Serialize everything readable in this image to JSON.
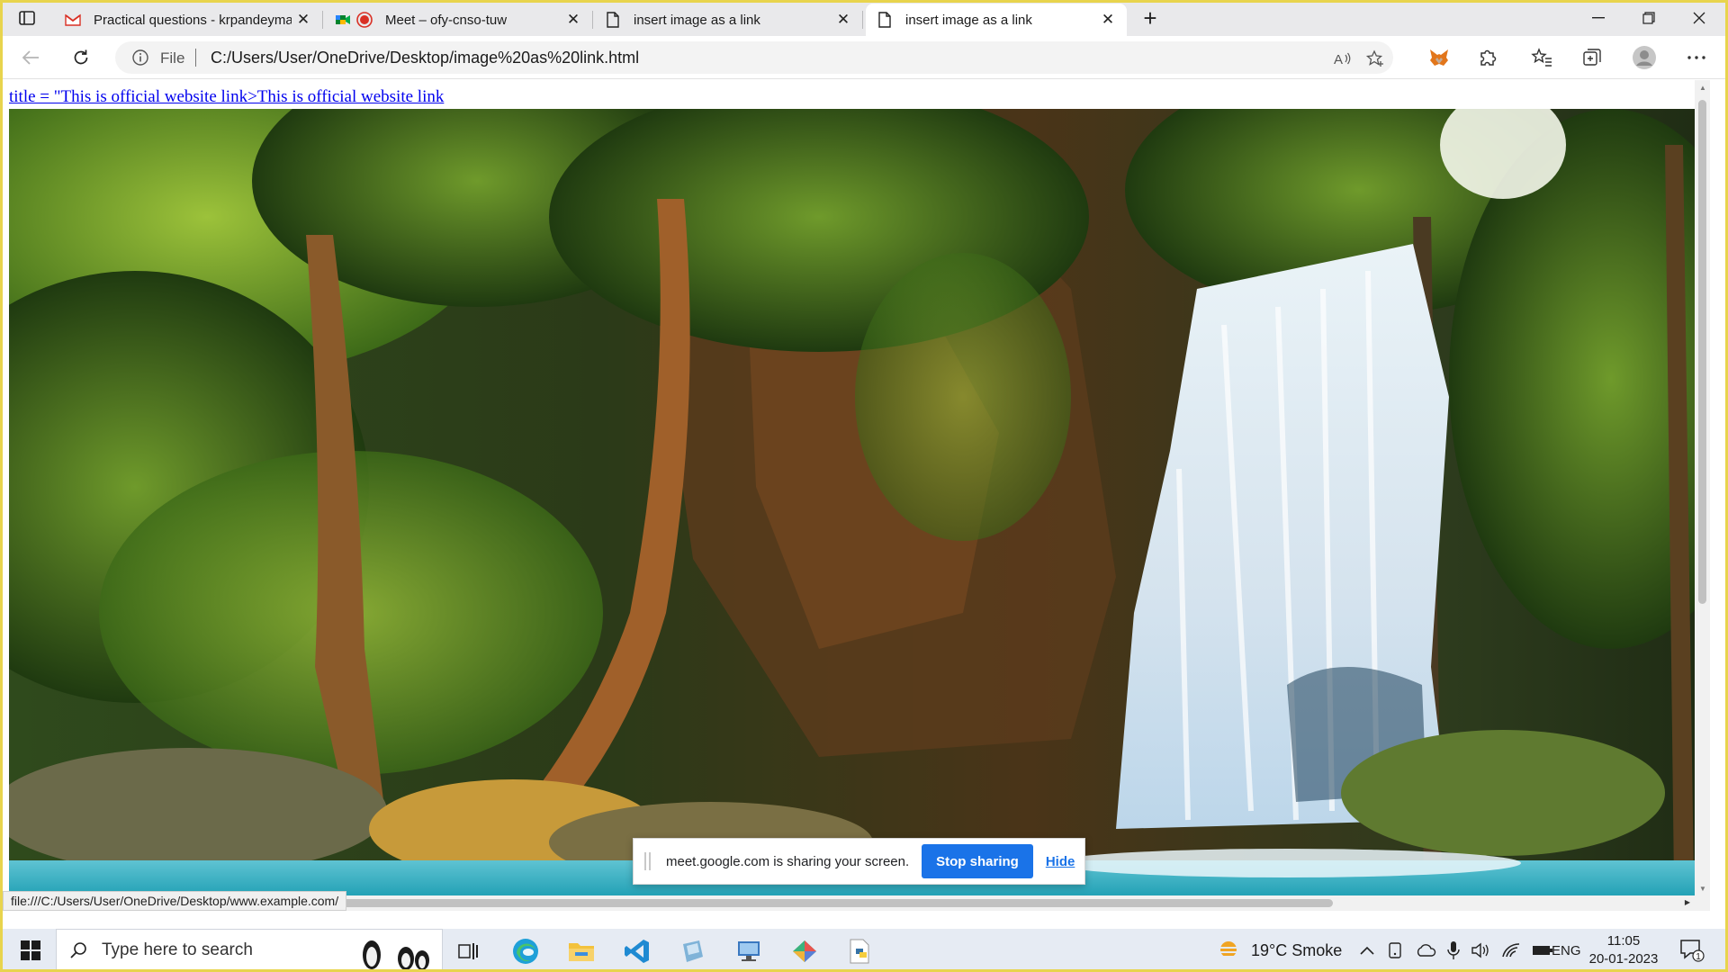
{
  "tabs": [
    {
      "title": "Practical questions - krpandeyma",
      "favicon": "gmail-icon",
      "state": "inactive"
    },
    {
      "title": "Meet – ofy-cnso-tuw",
      "favicon": "meet-icon",
      "state": "inactive",
      "recording": true
    },
    {
      "title": "insert image as a link",
      "favicon": "page-icon",
      "state": "inactive"
    },
    {
      "title": "insert image as a link",
      "favicon": "page-icon",
      "state": "active"
    }
  ],
  "address_bar": {
    "scheme_label": "File",
    "url": "C:/Users/User/OneDrive/Desktop/image%20as%20link.html"
  },
  "page": {
    "link_text": "title = \"This is official website link>This is official website link",
    "image_alt": "waterfall-photo",
    "status_url": "file:///C:/Users/User/OneDrive/Desktop/www.example.com/"
  },
  "share_bar": {
    "message": "meet.google.com is sharing your screen.",
    "stop_label": "Stop sharing",
    "hide_label": "Hide"
  },
  "taskbar": {
    "search_placeholder": "Type here to search",
    "weather": "19°C  Smoke",
    "language": "ENG",
    "time": "11:05",
    "date": "20-01-2023",
    "notification_count": "1"
  },
  "colors": {
    "accent": "#1a73e8",
    "link": "#0000ee",
    "frame": "#e8d44d",
    "tabstrip": "#e9e9eb"
  }
}
